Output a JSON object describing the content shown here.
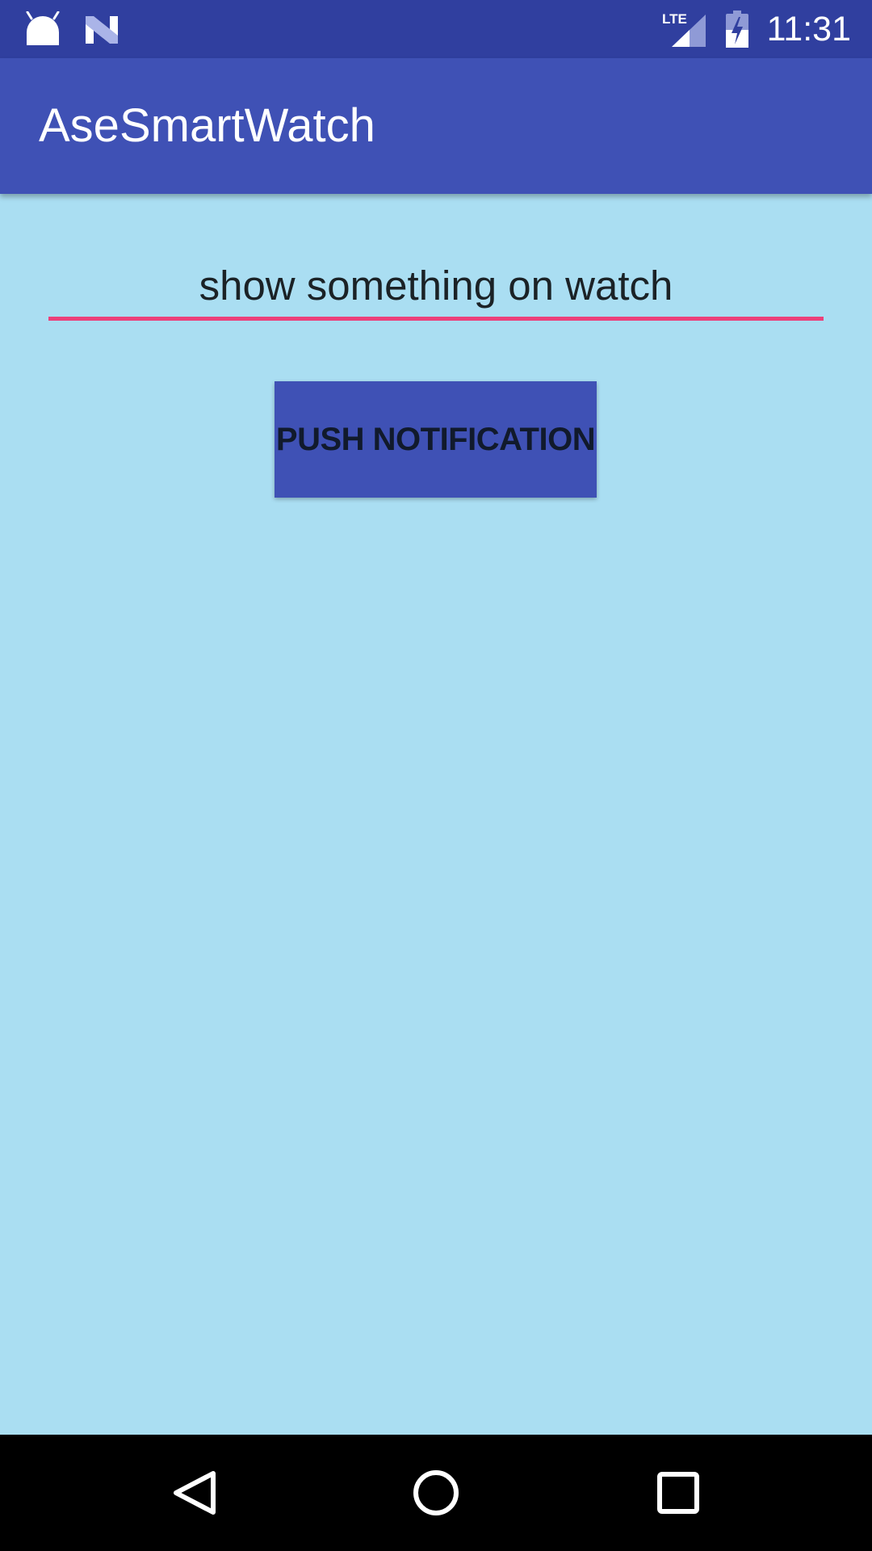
{
  "status_bar": {
    "time": "11:31",
    "network_label": "LTE",
    "icons": [
      "android-icon",
      "n-notification-icon",
      "lte-signal-icon",
      "battery-charging-icon"
    ]
  },
  "app_bar": {
    "title": "AseSmartWatch"
  },
  "main": {
    "message_input": {
      "value": "show something on watch"
    },
    "push_button_label": "PUSH NOTIFICATION"
  },
  "nav_bar": {
    "icons": [
      "back-icon",
      "home-icon",
      "recents-icon"
    ]
  },
  "colors": {
    "status_bar": "#303f9f",
    "app_bar": "#3f51b5",
    "background": "#aadef2",
    "accent_underline": "#ec407a",
    "button": "#3f51b5",
    "nav_bar": "#000000"
  }
}
